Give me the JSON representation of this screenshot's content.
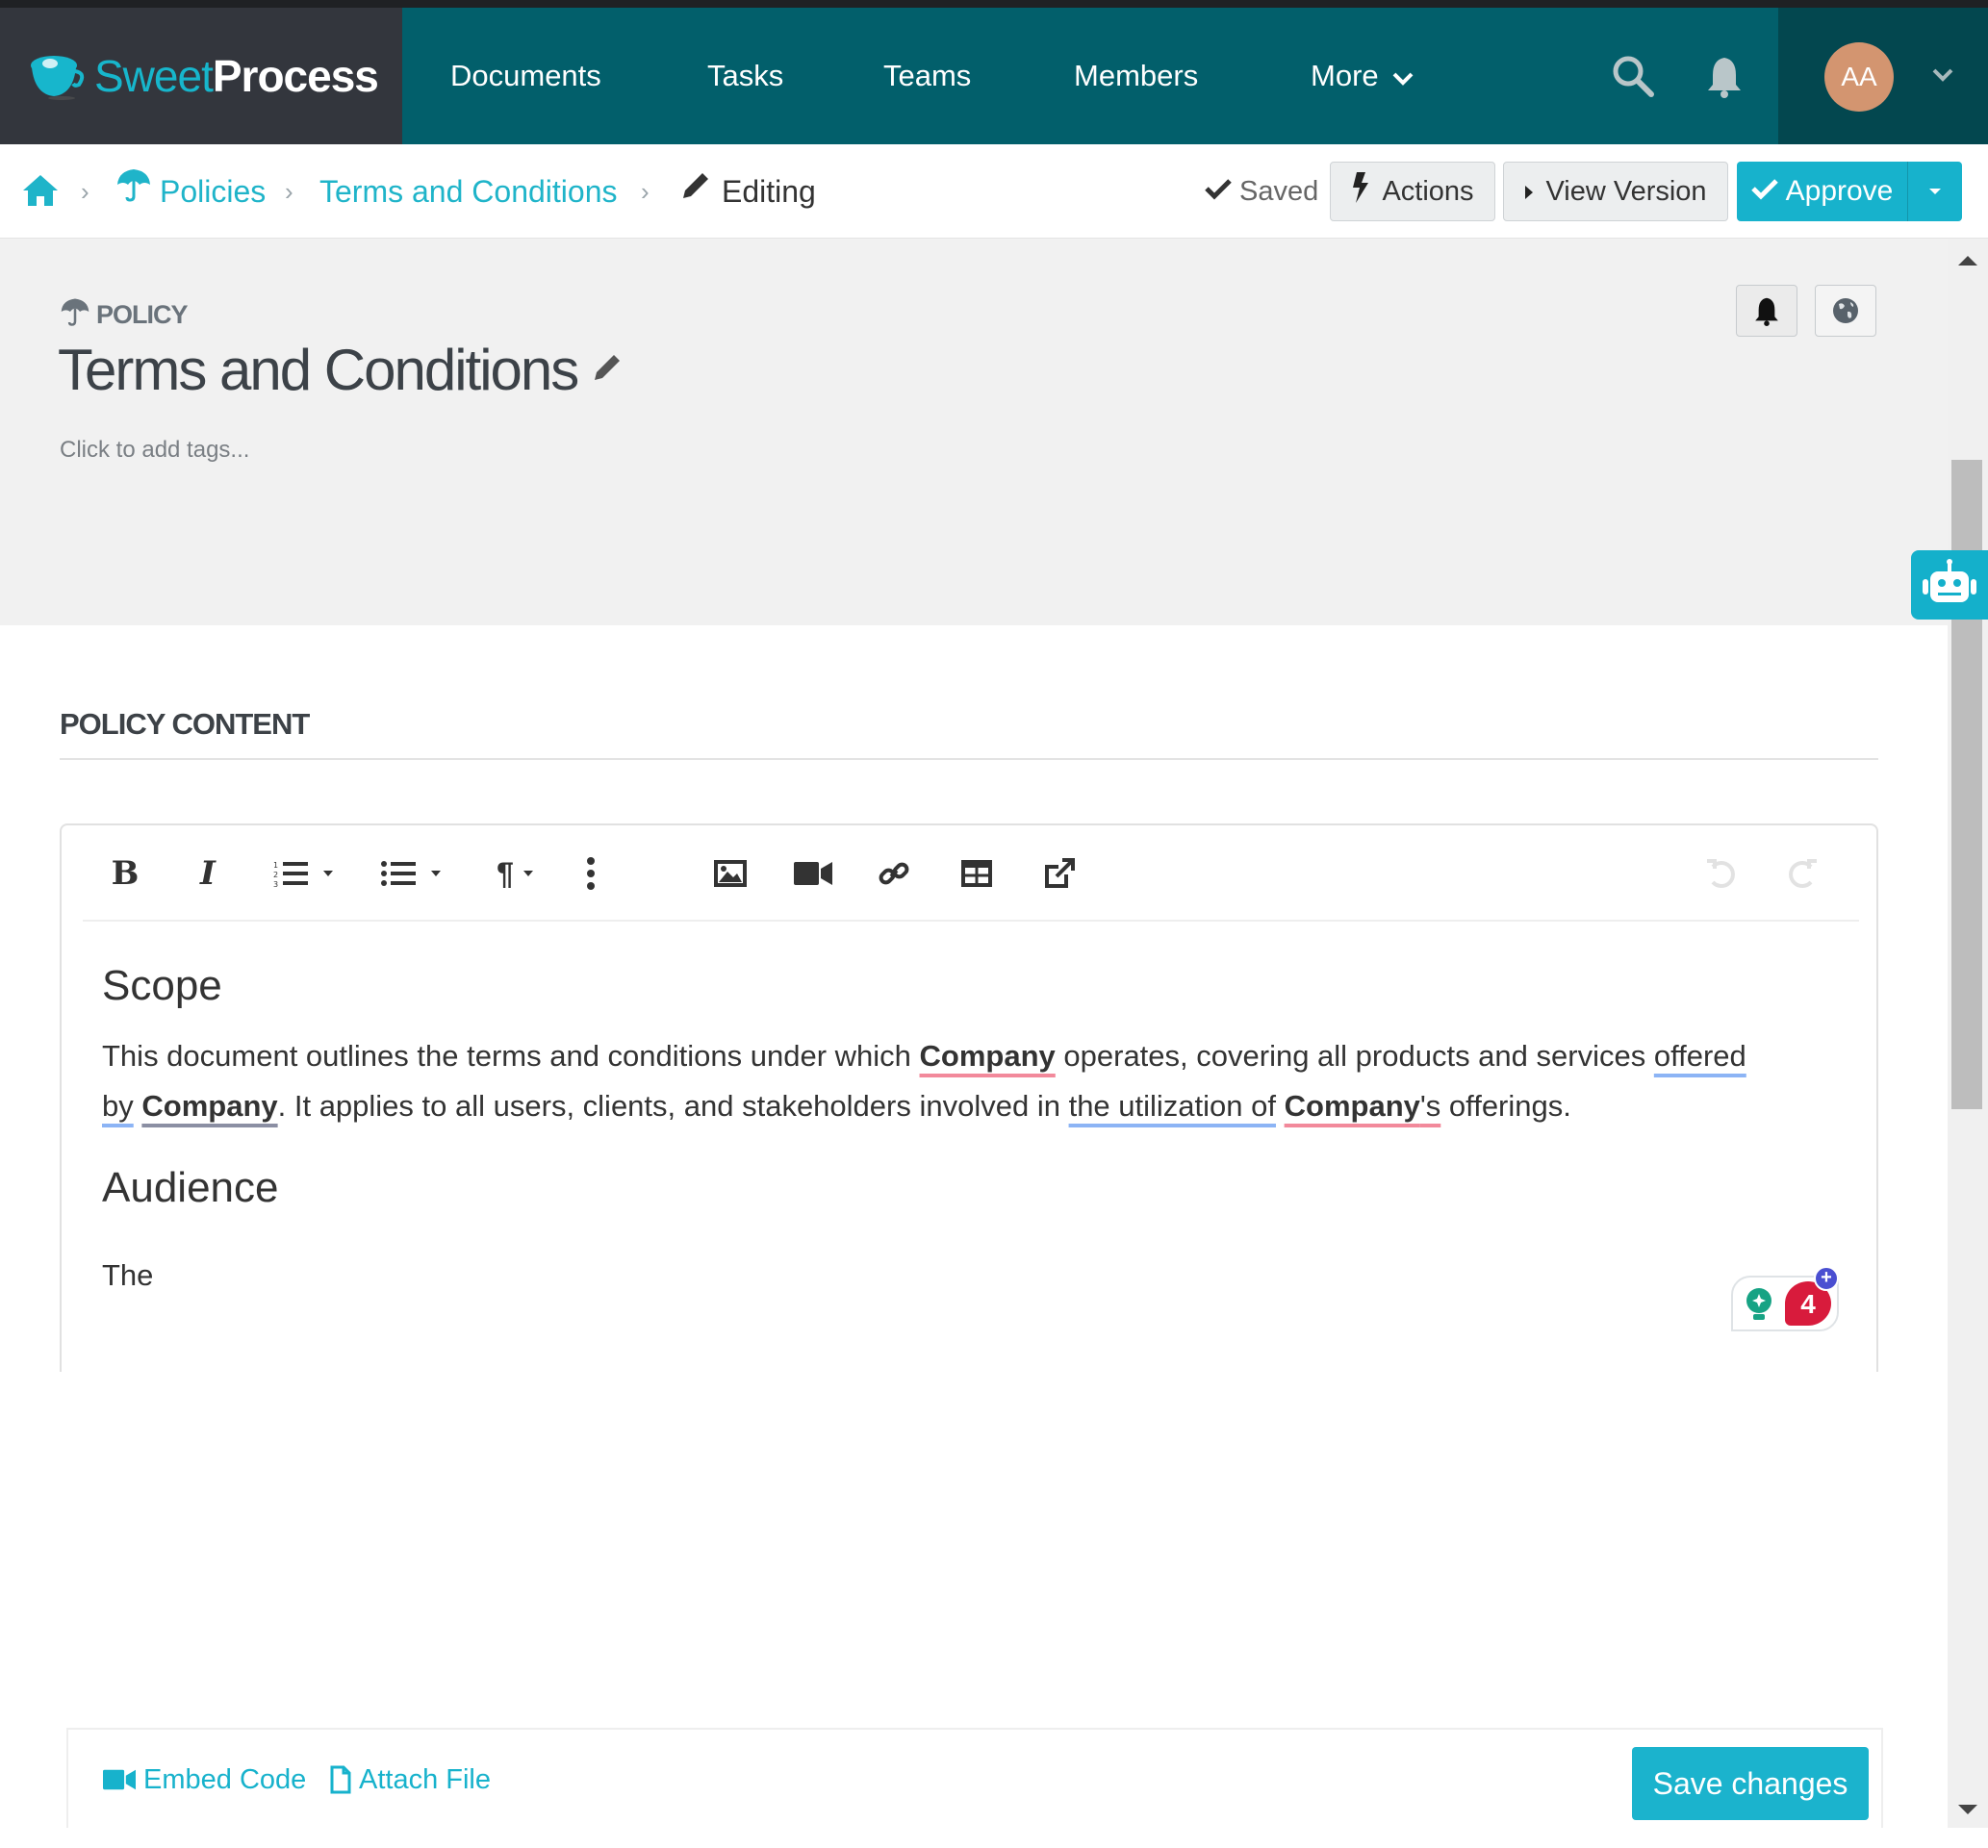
{
  "brand": {
    "name_part1": "Sweet",
    "name_part2": "Process",
    "accent": "#17b6cc"
  },
  "nav": {
    "items": [
      {
        "label": "Documents"
      },
      {
        "label": "Tasks"
      },
      {
        "label": "Teams"
      },
      {
        "label": "Members"
      },
      {
        "label": "More"
      }
    ],
    "icons": {
      "search": "search-icon",
      "notifications": "bell-icon",
      "more_chevron": "chevron-down-icon"
    },
    "user": {
      "initials": "AA",
      "avatar_color": "#d39570"
    }
  },
  "breadcrumb": {
    "home_icon": "home-icon",
    "items": [
      {
        "label": "Policies",
        "icon": "umbrella-icon"
      },
      {
        "label": "Terms and Conditions"
      },
      {
        "label": "Editing",
        "icon": "pencil-icon"
      }
    ]
  },
  "actions": {
    "saved_status": "Saved",
    "actions_label": "Actions",
    "view_version_label": "View Version",
    "approve_label": "Approve"
  },
  "document": {
    "type_label": "POLICY",
    "title": "Terms and Conditions",
    "tags_placeholder": "Click to add tags..."
  },
  "content_section": {
    "title": "POLICY CONTENT",
    "toolbar": [
      "bold",
      "italic",
      "ordered-list",
      "unordered-list",
      "paragraph-format",
      "more",
      "insert-image",
      "insert-video",
      "insert-link",
      "insert-table",
      "external-link",
      "undo",
      "redo"
    ],
    "body": {
      "heading1": "Scope",
      "para1": {
        "t1": "This document outlines the terms and conditions under which ",
        "company1": "Company",
        "t2": " operates, covering all products and services ",
        "offered": "offered",
        "by": "by",
        "company2": "Company",
        "t3": ". It applies to all users, clients, and stakeholders involved in ",
        "utilization": "the utilization of",
        "t4": " ",
        "company3": "Company",
        "apos": "'s",
        "t5": " offerings."
      },
      "heading2": "Audience",
      "para2": "The"
    },
    "assistant_badge": {
      "count": "4"
    }
  },
  "footer": {
    "embed_label": "Embed Code",
    "attach_label": "Attach File",
    "save_label": "Save changes"
  }
}
